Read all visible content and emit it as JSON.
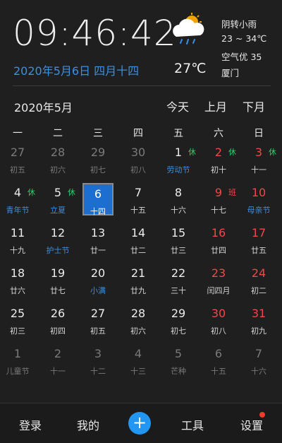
{
  "clock": {
    "time": "09:46:42",
    "date_line": "2020年5月6日 四月十四"
  },
  "weather": {
    "icon": "cloud-rain-icon",
    "temp": "27℃",
    "condition": "阴转小雨",
    "range": "23 ~ 34℃",
    "air": "空气优 35",
    "city": "厦门"
  },
  "calendar": {
    "month_title": "2020年5月",
    "nav": {
      "today": "今天",
      "prev": "上月",
      "next": "下月"
    },
    "weekdays": [
      "一",
      "二",
      "三",
      "四",
      "五",
      "六",
      "日"
    ],
    "weeks": [
      [
        {
          "day": "27",
          "lunar": "初五",
          "other": true
        },
        {
          "day": "28",
          "lunar": "初六",
          "other": true
        },
        {
          "day": "29",
          "lunar": "初七",
          "other": true
        },
        {
          "day": "30",
          "lunar": "初八",
          "other": true
        },
        {
          "day": "1",
          "lunar": "劳动节",
          "tag": "休",
          "lunarBlue": true
        },
        {
          "day": "2",
          "lunar": "初十",
          "tag": "休",
          "red": true
        },
        {
          "day": "3",
          "lunar": "十一",
          "tag": "休",
          "red": true
        }
      ],
      [
        {
          "day": "4",
          "lunar": "青年节",
          "tag": "休",
          "lunarBlue": true
        },
        {
          "day": "5",
          "lunar": "立夏",
          "tag": "休",
          "lunarBlue": true
        },
        {
          "day": "6",
          "lunar": "十四",
          "today": true
        },
        {
          "day": "7",
          "lunar": "十五"
        },
        {
          "day": "8",
          "lunar": "十六"
        },
        {
          "day": "9",
          "lunar": "十七",
          "tag": "班",
          "red": true,
          "tagRed": true
        },
        {
          "day": "10",
          "lunar": "母亲节",
          "red": true,
          "lunarBlue": true
        }
      ],
      [
        {
          "day": "11",
          "lunar": "十九"
        },
        {
          "day": "12",
          "lunar": "护士节",
          "lunarBlue": true
        },
        {
          "day": "13",
          "lunar": "廿一"
        },
        {
          "day": "14",
          "lunar": "廿二"
        },
        {
          "day": "15",
          "lunar": "廿三"
        },
        {
          "day": "16",
          "lunar": "廿四",
          "red": true
        },
        {
          "day": "17",
          "lunar": "廿五",
          "red": true
        }
      ],
      [
        {
          "day": "18",
          "lunar": "廿六"
        },
        {
          "day": "19",
          "lunar": "廿七"
        },
        {
          "day": "20",
          "lunar": "小满",
          "lunarBlue": true
        },
        {
          "day": "21",
          "lunar": "廿九"
        },
        {
          "day": "22",
          "lunar": "三十"
        },
        {
          "day": "23",
          "lunar": "闰四月",
          "red": true
        },
        {
          "day": "24",
          "lunar": "初二",
          "red": true
        }
      ],
      [
        {
          "day": "25",
          "lunar": "初三"
        },
        {
          "day": "26",
          "lunar": "初四"
        },
        {
          "day": "27",
          "lunar": "初五"
        },
        {
          "day": "28",
          "lunar": "初六"
        },
        {
          "day": "29",
          "lunar": "初七"
        },
        {
          "day": "30",
          "lunar": "初八",
          "red": true
        },
        {
          "day": "31",
          "lunar": "初九",
          "red": true
        }
      ],
      [
        {
          "day": "1",
          "lunar": "儿童节",
          "other": true
        },
        {
          "day": "2",
          "lunar": "十一",
          "other": true
        },
        {
          "day": "3",
          "lunar": "十二",
          "other": true
        },
        {
          "day": "4",
          "lunar": "十三",
          "other": true
        },
        {
          "day": "5",
          "lunar": "芒种",
          "other": true
        },
        {
          "day": "6",
          "lunar": "十五",
          "other": true
        },
        {
          "day": "7",
          "lunar": "十六",
          "other": true
        }
      ]
    ]
  },
  "bottom_nav": {
    "login": "登录",
    "mine": "我的",
    "add": "+",
    "tools": "工具",
    "settings": "设置"
  },
  "colors": {
    "accent_blue": "#3d8fe0",
    "holiday_red": "#f04848",
    "rest_tag_green": "#2ed06a",
    "selected_bg": "#1c6fd0",
    "plus_button": "#2196f3"
  }
}
